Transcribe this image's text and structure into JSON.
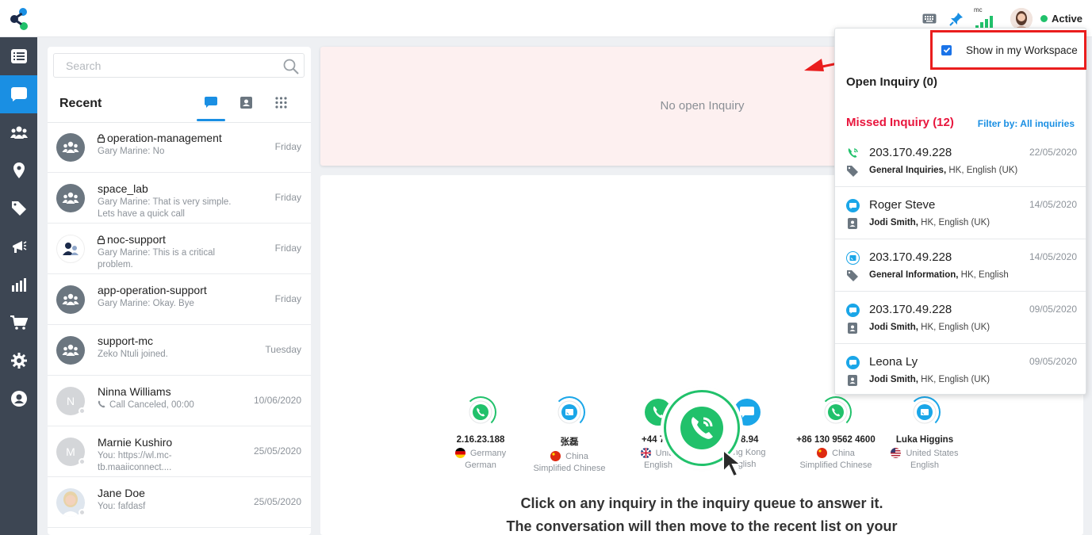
{
  "topbar": {
    "signal_label": "mc",
    "status_text": "Active",
    "status_color": "#21c16b"
  },
  "nav": {
    "items": [
      {
        "icon": "list-icon"
      },
      {
        "icon": "chat-icon",
        "active": true
      },
      {
        "icon": "users-icon"
      },
      {
        "icon": "location-icon"
      },
      {
        "icon": "tag-icon"
      },
      {
        "icon": "megaphone-icon"
      },
      {
        "icon": "analytics-icon"
      },
      {
        "icon": "cart-icon"
      },
      {
        "icon": "gear-icon"
      },
      {
        "icon": "account-icon"
      }
    ]
  },
  "recent": {
    "search_placeholder": "Search",
    "title": "Recent",
    "items": [
      {
        "name": "operation-management",
        "locked": true,
        "sub": "Gary Marine: No",
        "date": "Friday",
        "avatar": "group"
      },
      {
        "name": "space_lab",
        "locked": false,
        "sub": "Gary Marine: That is very simple. Lets have a quick call",
        "date": "Friday",
        "avatar": "group"
      },
      {
        "name": "noc-support",
        "locked": true,
        "sub": "Gary Marine: This is a critical problem.",
        "date": "Friday",
        "avatar": "noc"
      },
      {
        "name": "app-operation-support",
        "locked": false,
        "sub": "Gary Marine: Okay. Bye",
        "date": "Friday",
        "avatar": "group"
      },
      {
        "name": "support-mc",
        "locked": false,
        "sub": "Zeko Ntuli joined.",
        "date": "Tuesday",
        "avatar": "group"
      },
      {
        "name": "Ninna Williams",
        "locked": false,
        "sub": "Call Canceled, 00:00",
        "date": "10/06/2020",
        "avatar": "letter",
        "letter": "N"
      },
      {
        "name": "Marnie Kushiro",
        "locked": false,
        "sub": "You: https://wl.mc-tb.maaiiconnect....",
        "date": "25/05/2020",
        "avatar": "letter",
        "letter": "M"
      },
      {
        "name": "Jane Doe",
        "locked": false,
        "sub": "You: fafdasf",
        "date": "25/05/2020",
        "avatar": "photo"
      }
    ]
  },
  "open_inquiry": {
    "empty_text": "No open Inquiry"
  },
  "queue": {
    "items": [
      {
        "name": "2.16.23.188",
        "country": "Germany",
        "language": "German",
        "type": "call"
      },
      {
        "name": "张磊",
        "country": "China",
        "language": "Simplified Chinese",
        "type": "chat"
      },
      {
        "name": "+44 785",
        "country": "Unite",
        "language": "English",
        "type": "call-filled"
      },
      {
        "name": "58.94",
        "country": "ong Kong",
        "language": "glish",
        "type": "chat-filled"
      },
      {
        "name": "+86 130 9562 4600",
        "country": "China",
        "language": "Simplified Chinese",
        "type": "call"
      },
      {
        "name": "Luka Higgins",
        "country": "United States",
        "language": "English",
        "type": "chat"
      }
    ],
    "instruction_line1": "Click on any inquiry in the inquiry queue to answer it.",
    "instruction_line2": "The conversation will then move to the recent list on your"
  },
  "dropdown": {
    "workspace_label": "Show in my Workspace",
    "workspace_checked": true,
    "open_title": "Open Inquiry (0)",
    "missed_title": "Missed Inquiry (12)",
    "filter_label": "Filter by: All inquiries",
    "missed": [
      {
        "name": "203.170.49.228",
        "date": "22/05/2020",
        "sub_bold": "General Inquiries,",
        "sub_rest": " HK, English (UK)",
        "icon": "phone-icon",
        "sub_icon": "tag-icon"
      },
      {
        "name": "Roger Steve",
        "date": "14/05/2020",
        "sub_bold": "Jodi Smith,",
        "sub_rest": " HK, English (UK)",
        "icon": "chat-bubble-icon",
        "sub_icon": "contact-card-icon"
      },
      {
        "name": "203.170.49.228",
        "date": "14/05/2020",
        "sub_bold": "General Information,",
        "sub_rest": " HK, English",
        "icon": "web-chat-icon",
        "sub_icon": "tag-icon"
      },
      {
        "name": "203.170.49.228",
        "date": "09/05/2020",
        "sub_bold": "Jodi Smith,",
        "sub_rest": " HK, English (UK)",
        "icon": "chat-bubble-icon",
        "sub_icon": "contact-card-icon"
      },
      {
        "name": "Leona Ly",
        "date": "09/05/2020",
        "sub_bold": "Jodi Smith,",
        "sub_rest": " HK, English (UK)",
        "icon": "chat-bubble-icon",
        "sub_icon": "contact-card-icon"
      }
    ]
  },
  "colors": {
    "accent": "#1a8fe3",
    "nav_bg": "#3d4653",
    "missed_red": "#e8163d",
    "green": "#21c16b",
    "highlight_red": "#ea1d1d"
  }
}
